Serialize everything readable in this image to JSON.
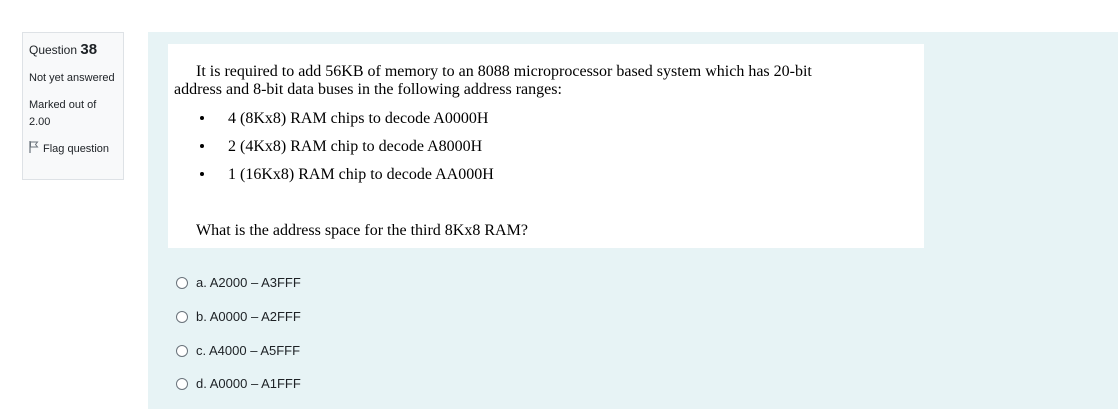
{
  "info": {
    "question_label": "Question",
    "question_number": "38",
    "state": "Not yet answered",
    "grade": "Marked out of 2.00",
    "flag_label": "Flag question"
  },
  "question": {
    "paragraph_line1": "It is required to add 56KB of memory to an 8088 microprocessor based system which has 20-bit",
    "paragraph_line2": "address and 8-bit data buses in the following address ranges:",
    "bullets": [
      "4 (8Kx8) RAM chips to decode A0000H",
      "2 (4Kx8) RAM chip to decode A8000H",
      "1 (16Kx8) RAM chip to decode AA000H"
    ],
    "prompt": "What is the address space for the third 8Kx8 RAM?"
  },
  "options": [
    "a. A2000 – A3FFF",
    "b. A0000 – A2FFF",
    "c. A4000 – A5FFF",
    "d. A0000 – A1FFF"
  ],
  "colors": {
    "content_bg": "#e7f3f5",
    "info_bg": "#f8f9fa",
    "text": "#1d2125"
  }
}
